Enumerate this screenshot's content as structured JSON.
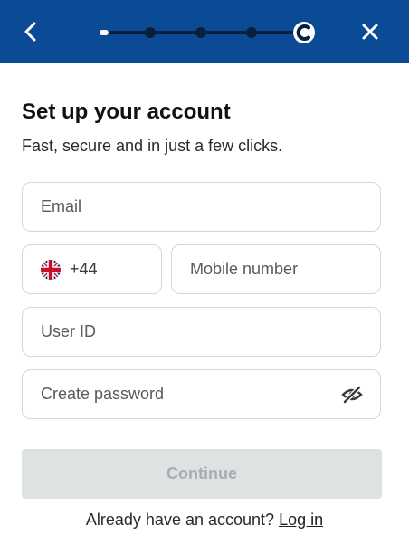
{
  "header": {
    "background": "#0b4a94",
    "back_icon": "chevron-left-icon",
    "close_icon": "close-icon",
    "progress": {
      "steps": 5,
      "current_step": 5,
      "logo_letter": "C"
    }
  },
  "form": {
    "title": "Set up your account",
    "subtitle": "Fast, secure and in just a few clicks.",
    "email": {
      "placeholder": "Email",
      "value": ""
    },
    "phone_code": {
      "flag_icon": "uk-flag-icon",
      "code": "+44"
    },
    "mobile": {
      "placeholder": "Mobile number",
      "value": ""
    },
    "user_id": {
      "placeholder": "User ID",
      "value": ""
    },
    "password": {
      "placeholder": "Create password",
      "value": "",
      "visibility_icon": "eye-slash-icon"
    },
    "continue_label": "Continue"
  },
  "footer": {
    "prompt": "Already have an account?",
    "login_link": "Log in"
  }
}
